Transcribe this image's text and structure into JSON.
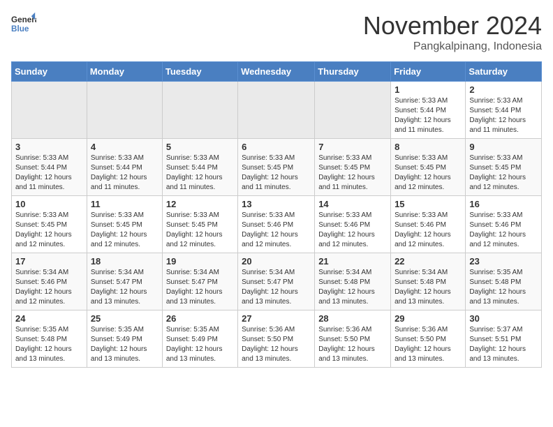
{
  "logo": {
    "text1": "General",
    "text2": "Blue"
  },
  "header": {
    "month": "November 2024",
    "location": "Pangkalpinang, Indonesia"
  },
  "weekdays": [
    "Sunday",
    "Monday",
    "Tuesday",
    "Wednesday",
    "Thursday",
    "Friday",
    "Saturday"
  ],
  "weeks": [
    [
      {
        "day": "",
        "empty": true
      },
      {
        "day": "",
        "empty": true
      },
      {
        "day": "",
        "empty": true
      },
      {
        "day": "",
        "empty": true
      },
      {
        "day": "",
        "empty": true
      },
      {
        "day": "1",
        "sunrise": "Sunrise: 5:33 AM",
        "sunset": "Sunset: 5:44 PM",
        "daylight": "Daylight: 12 hours and 11 minutes."
      },
      {
        "day": "2",
        "sunrise": "Sunrise: 5:33 AM",
        "sunset": "Sunset: 5:44 PM",
        "daylight": "Daylight: 12 hours and 11 minutes."
      }
    ],
    [
      {
        "day": "3",
        "sunrise": "Sunrise: 5:33 AM",
        "sunset": "Sunset: 5:44 PM",
        "daylight": "Daylight: 12 hours and 11 minutes."
      },
      {
        "day": "4",
        "sunrise": "Sunrise: 5:33 AM",
        "sunset": "Sunset: 5:44 PM",
        "daylight": "Daylight: 12 hours and 11 minutes."
      },
      {
        "day": "5",
        "sunrise": "Sunrise: 5:33 AM",
        "sunset": "Sunset: 5:44 PM",
        "daylight": "Daylight: 12 hours and 11 minutes."
      },
      {
        "day": "6",
        "sunrise": "Sunrise: 5:33 AM",
        "sunset": "Sunset: 5:45 PM",
        "daylight": "Daylight: 12 hours and 11 minutes."
      },
      {
        "day": "7",
        "sunrise": "Sunrise: 5:33 AM",
        "sunset": "Sunset: 5:45 PM",
        "daylight": "Daylight: 12 hours and 11 minutes."
      },
      {
        "day": "8",
        "sunrise": "Sunrise: 5:33 AM",
        "sunset": "Sunset: 5:45 PM",
        "daylight": "Daylight: 12 hours and 12 minutes."
      },
      {
        "day": "9",
        "sunrise": "Sunrise: 5:33 AM",
        "sunset": "Sunset: 5:45 PM",
        "daylight": "Daylight: 12 hours and 12 minutes."
      }
    ],
    [
      {
        "day": "10",
        "sunrise": "Sunrise: 5:33 AM",
        "sunset": "Sunset: 5:45 PM",
        "daylight": "Daylight: 12 hours and 12 minutes."
      },
      {
        "day": "11",
        "sunrise": "Sunrise: 5:33 AM",
        "sunset": "Sunset: 5:45 PM",
        "daylight": "Daylight: 12 hours and 12 minutes."
      },
      {
        "day": "12",
        "sunrise": "Sunrise: 5:33 AM",
        "sunset": "Sunset: 5:45 PM",
        "daylight": "Daylight: 12 hours and 12 minutes."
      },
      {
        "day": "13",
        "sunrise": "Sunrise: 5:33 AM",
        "sunset": "Sunset: 5:46 PM",
        "daylight": "Daylight: 12 hours and 12 minutes."
      },
      {
        "day": "14",
        "sunrise": "Sunrise: 5:33 AM",
        "sunset": "Sunset: 5:46 PM",
        "daylight": "Daylight: 12 hours and 12 minutes."
      },
      {
        "day": "15",
        "sunrise": "Sunrise: 5:33 AM",
        "sunset": "Sunset: 5:46 PM",
        "daylight": "Daylight: 12 hours and 12 minutes."
      },
      {
        "day": "16",
        "sunrise": "Sunrise: 5:33 AM",
        "sunset": "Sunset: 5:46 PM",
        "daylight": "Daylight: 12 hours and 12 minutes."
      }
    ],
    [
      {
        "day": "17",
        "sunrise": "Sunrise: 5:34 AM",
        "sunset": "Sunset: 5:46 PM",
        "daylight": "Daylight: 12 hours and 12 minutes."
      },
      {
        "day": "18",
        "sunrise": "Sunrise: 5:34 AM",
        "sunset": "Sunset: 5:47 PM",
        "daylight": "Daylight: 12 hours and 13 minutes."
      },
      {
        "day": "19",
        "sunrise": "Sunrise: 5:34 AM",
        "sunset": "Sunset: 5:47 PM",
        "daylight": "Daylight: 12 hours and 13 minutes."
      },
      {
        "day": "20",
        "sunrise": "Sunrise: 5:34 AM",
        "sunset": "Sunset: 5:47 PM",
        "daylight": "Daylight: 12 hours and 13 minutes."
      },
      {
        "day": "21",
        "sunrise": "Sunrise: 5:34 AM",
        "sunset": "Sunset: 5:48 PM",
        "daylight": "Daylight: 12 hours and 13 minutes."
      },
      {
        "day": "22",
        "sunrise": "Sunrise: 5:34 AM",
        "sunset": "Sunset: 5:48 PM",
        "daylight": "Daylight: 12 hours and 13 minutes."
      },
      {
        "day": "23",
        "sunrise": "Sunrise: 5:35 AM",
        "sunset": "Sunset: 5:48 PM",
        "daylight": "Daylight: 12 hours and 13 minutes."
      }
    ],
    [
      {
        "day": "24",
        "sunrise": "Sunrise: 5:35 AM",
        "sunset": "Sunset: 5:48 PM",
        "daylight": "Daylight: 12 hours and 13 minutes."
      },
      {
        "day": "25",
        "sunrise": "Sunrise: 5:35 AM",
        "sunset": "Sunset: 5:49 PM",
        "daylight": "Daylight: 12 hours and 13 minutes."
      },
      {
        "day": "26",
        "sunrise": "Sunrise: 5:35 AM",
        "sunset": "Sunset: 5:49 PM",
        "daylight": "Daylight: 12 hours and 13 minutes."
      },
      {
        "day": "27",
        "sunrise": "Sunrise: 5:36 AM",
        "sunset": "Sunset: 5:50 PM",
        "daylight": "Daylight: 12 hours and 13 minutes."
      },
      {
        "day": "28",
        "sunrise": "Sunrise: 5:36 AM",
        "sunset": "Sunset: 5:50 PM",
        "daylight": "Daylight: 12 hours and 13 minutes."
      },
      {
        "day": "29",
        "sunrise": "Sunrise: 5:36 AM",
        "sunset": "Sunset: 5:50 PM",
        "daylight": "Daylight: 12 hours and 13 minutes."
      },
      {
        "day": "30",
        "sunrise": "Sunrise: 5:37 AM",
        "sunset": "Sunset: 5:51 PM",
        "daylight": "Daylight: 12 hours and 13 minutes."
      }
    ]
  ]
}
